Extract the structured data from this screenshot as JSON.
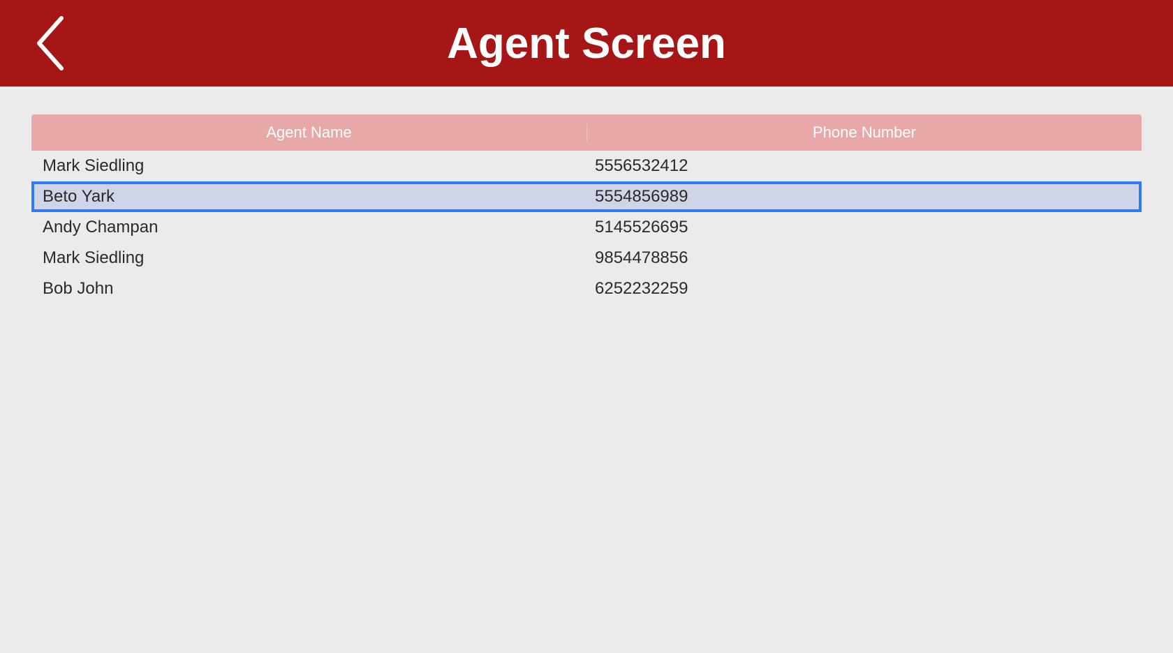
{
  "header": {
    "title": "Agent Screen"
  },
  "table": {
    "headers": {
      "name": "Agent Name",
      "phone": "Phone Number"
    },
    "rows": [
      {
        "name": "Mark Siedling",
        "phone": "5556532412",
        "selected": false
      },
      {
        "name": "Beto Yark",
        "phone": "5554856989",
        "selected": true
      },
      {
        "name": "Andy Champan",
        "phone": "5145526695",
        "selected": false
      },
      {
        "name": "Mark Siedling",
        "phone": "9854478856",
        "selected": false
      },
      {
        "name": "Bob John",
        "phone": "6252232259",
        "selected": false
      }
    ]
  }
}
